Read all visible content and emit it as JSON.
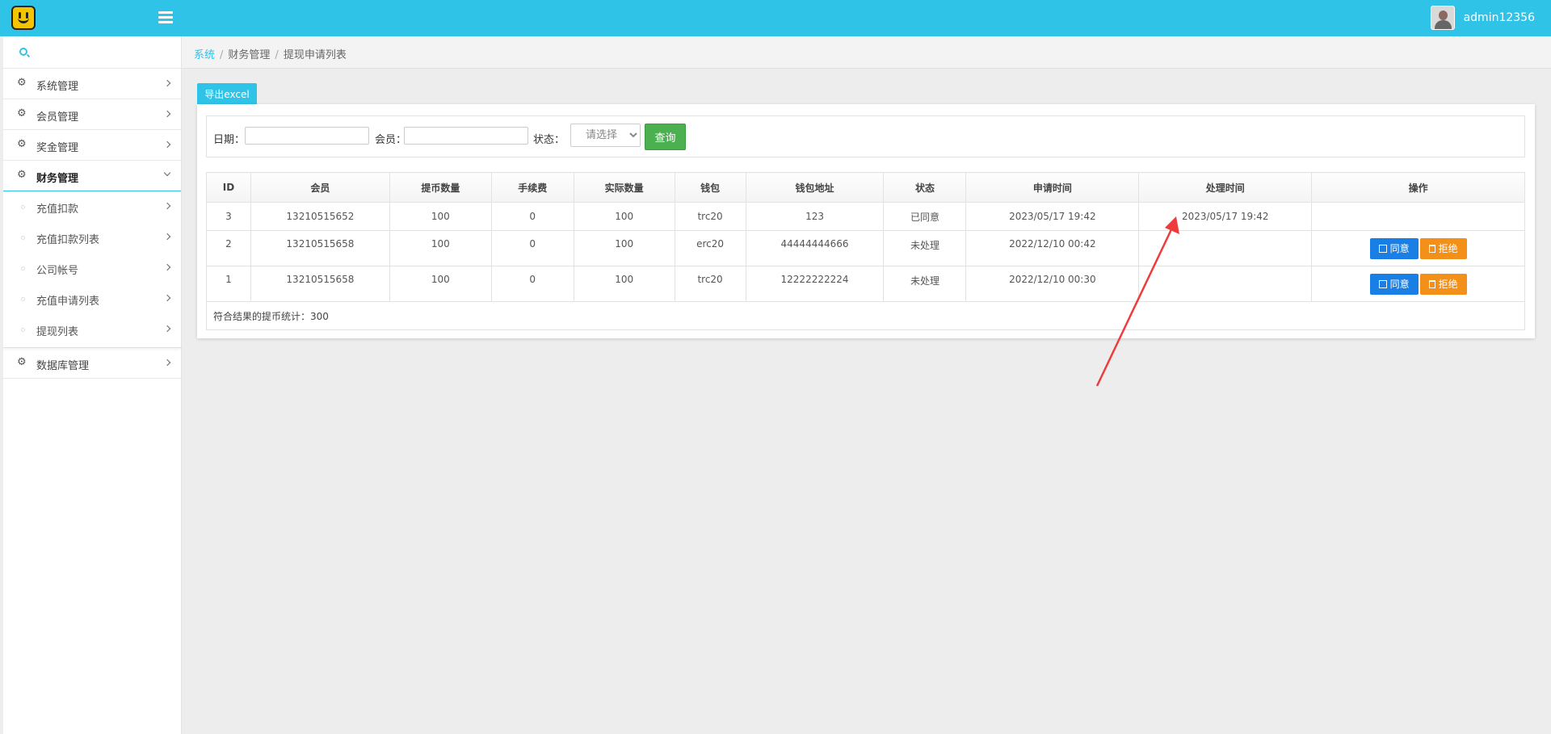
{
  "header": {
    "username": "admin12356"
  },
  "sidebar": {
    "search": {
      "placeholder": ""
    },
    "menus": [
      {
        "label": "系统管理",
        "icon": "gear-icon"
      },
      {
        "label": "会员管理",
        "icon": "gear-icon"
      },
      {
        "label": "奖金管理",
        "icon": "gear-icon"
      },
      {
        "label": "财务管理",
        "icon": "gear-icon"
      },
      {
        "label": "数据库管理",
        "icon": "gear-icon"
      }
    ],
    "finance_sub": [
      {
        "label": "充值扣款"
      },
      {
        "label": "充值扣款列表"
      },
      {
        "label": "公司帐号"
      },
      {
        "label": "充值申请列表"
      },
      {
        "label": "提现列表"
      }
    ]
  },
  "breadcrumb": {
    "items": [
      "系统",
      "财务管理",
      "提现申请列表"
    ]
  },
  "toolbar": {
    "export_label": "导出excel"
  },
  "filter": {
    "date_label": "日期：",
    "member_label": "会员：",
    "status_label": "状态：",
    "status_selected": "请选择",
    "query_label": "查询"
  },
  "table": {
    "headers": [
      "ID",
      "会员",
      "提币数量",
      "手续费",
      "实际数量",
      "钱包",
      "钱包地址",
      "状态",
      "申请时间",
      "处理时间",
      "操作"
    ],
    "rows": [
      {
        "id": "3",
        "member": "13210515652",
        "amount": "100",
        "fee": "0",
        "actual": "100",
        "wallet": "trc20",
        "address": "123",
        "status": "已同意",
        "apply_time": "2023/05/17 19:42",
        "process_time": "2023/05/17 19:42"
      },
      {
        "id": "2",
        "member": "13210515658",
        "amount": "100",
        "fee": "0",
        "actual": "100",
        "wallet": "erc20",
        "address": "44444444666",
        "status": "未处理",
        "apply_time": "2022/12/10 00:42",
        "process_time": "",
        "agree": "同意",
        "reject": "拒绝"
      },
      {
        "id": "1",
        "member": "13210515658",
        "amount": "100",
        "fee": "0",
        "actual": "100",
        "wallet": "trc20",
        "address": "12222222224",
        "status": "未处理",
        "apply_time": "2022/12/10 00:30",
        "process_time": "",
        "agree": "同意",
        "reject": "拒绝"
      }
    ],
    "summary": "符合结果的提币统计：300"
  },
  "colors": {
    "brand": "#2ec3e7",
    "agree": "#1a7fe5",
    "reject": "#f39019",
    "query": "#4caf50",
    "arrow": "#ef3b3b"
  }
}
